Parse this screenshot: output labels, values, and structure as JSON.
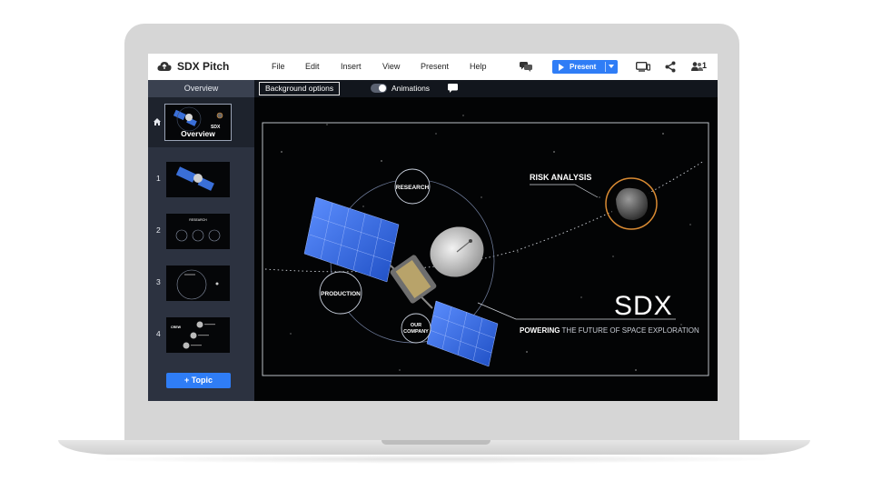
{
  "app": {
    "title": "SDX Pitch"
  },
  "menu": {
    "file": "File",
    "edit": "Edit",
    "insert": "Insert",
    "view": "View",
    "present": "Present",
    "help": "Help"
  },
  "toolbar": {
    "present_label": "Present",
    "overview": "Overview",
    "background_options": "Background options",
    "animations": "Animations",
    "users_count": "1"
  },
  "sidebar": {
    "overview_caption": "Overview",
    "slides": [
      "1",
      "2",
      "3",
      "4"
    ],
    "add_topic": "+ Topic"
  },
  "slide": {
    "topics": {
      "research": "RESEARCH",
      "production": "PRODUCTION",
      "our": "OUR",
      "company": "COMPANY"
    },
    "risk_analysis": "RISK ANALYSIS",
    "brand": "SDX",
    "tagline_bold": "POWERING",
    "tagline_rest": " THE FUTURE OF SPACE EXPLORATION"
  },
  "thumbnails": {
    "slide2_title": "RESEARCH",
    "slide4_label": "CREW"
  },
  "colors": {
    "accent": "#2f7df6",
    "orange_ring": "#d98a32",
    "sidebar": "#2c3240"
  }
}
